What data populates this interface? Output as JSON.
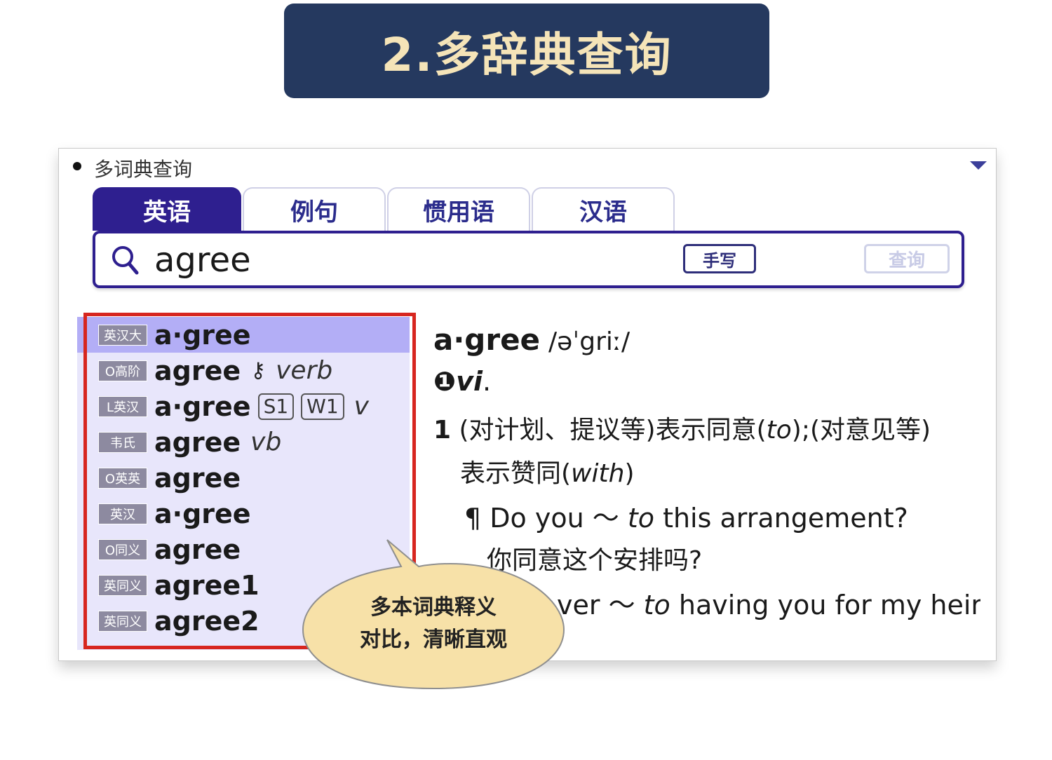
{
  "banner": {
    "title": "2.多辞典查询"
  },
  "window": {
    "title": "多词典查询"
  },
  "tabs": [
    "英语",
    "例句",
    "惯用语",
    "汉语"
  ],
  "search": {
    "value": "agree",
    "handwrite_label": "手写",
    "query_label": "查询"
  },
  "dict_list": [
    {
      "badge": "英汉大",
      "headword": "a·gree",
      "suffix": "",
      "selected": true
    },
    {
      "badge": "O高阶",
      "headword": "agree",
      "suffix": "verb",
      "key": true
    },
    {
      "badge": "L英汉",
      "headword": "a·gree",
      "tags": [
        "S1",
        "W1"
      ],
      "suffix": "v"
    },
    {
      "badge": "韦氏",
      "headword": "agree",
      "suffix": "vb"
    },
    {
      "badge": "O英英",
      "headword": "agree",
      "suffix": ""
    },
    {
      "badge": "英汉",
      "headword": "a·gree",
      "suffix": ""
    },
    {
      "badge": "O同义",
      "headword": "agree",
      "suffix": ""
    },
    {
      "badge": "英同义",
      "headword": "agree1",
      "suffix": ""
    },
    {
      "badge": "英同义",
      "headword": "agree2",
      "suffix": ""
    }
  ],
  "definition": {
    "headword": "a·gree",
    "pronunciation": "/əˈgriː/",
    "sense_marker": "❶",
    "pos": "vi",
    "sense_number": "1",
    "sense_text_1a": "(对计划、提议等)表示同意(",
    "sense_text_1b": "to",
    "sense_text_1c": ");(对意见等)",
    "sense_text_2a": "表示赞同(",
    "sense_text_2b": "with",
    "sense_text_2c": ")",
    "example_1a": "¶ Do you ～ ",
    "example_1b": "to",
    "example_1c": " this arrangement?",
    "example_1_translation": "你同意这个安排吗?",
    "example_2a": "ver ～ ",
    "example_2b": "to",
    "example_2c": " having you for my heir"
  },
  "callout": {
    "line1": "多本词典释义",
    "line2": "对比，清晰直观"
  },
  "colors": {
    "banner": "#25395f",
    "banner_text": "#f5e4b8",
    "accent": "#2e1f8f",
    "highlight_frame": "#d7261f",
    "list_bg": "#e8e6fb",
    "list_selected": "#b3aef6",
    "callout": "#f7e1a8"
  }
}
